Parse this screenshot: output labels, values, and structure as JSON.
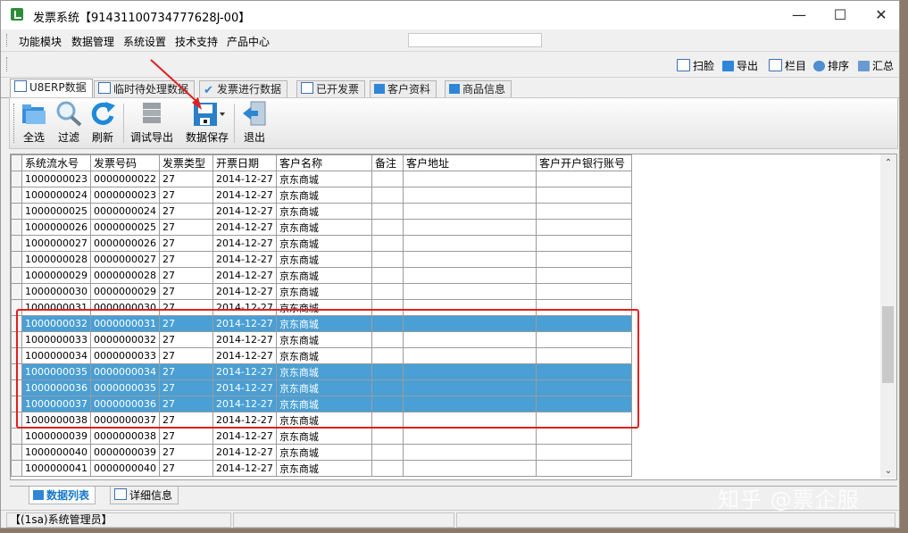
{
  "window": {
    "title": "发票系统【91431100734777628J-00】"
  },
  "menu": {
    "items": [
      "功能模块",
      "数据管理",
      "系统设置",
      "技术支持",
      "产品中心"
    ]
  },
  "toolbar2": {
    "items": [
      "扫脸",
      "导出",
      "栏目",
      "排序",
      "汇总"
    ]
  },
  "tabs": [
    "U8ERP数据",
    "临时待处理数据",
    "发票进行数据",
    "已开发票",
    "客户资料",
    "商品信息"
  ],
  "ribbon": {
    "buttons": [
      "全选",
      "过滤",
      "刷新",
      "调试导出",
      "数据保存",
      "退出"
    ]
  },
  "grid": {
    "columns": [
      "系统流水号",
      "发票号码",
      "发票类型",
      "开票日期",
      "客户名称",
      "备注",
      "客户地址",
      "客户开户银行账号"
    ],
    "rows": [
      {
        "cells": [
          "1000000023",
          "0000000022",
          "27",
          "2014-12-27",
          "京东商城",
          "",
          "",
          ""
        ],
        "selected": false
      },
      {
        "cells": [
          "1000000024",
          "0000000023",
          "27",
          "2014-12-27",
          "京东商城",
          "",
          "",
          ""
        ],
        "selected": false
      },
      {
        "cells": [
          "1000000025",
          "0000000024",
          "27",
          "2014-12-27",
          "京东商城",
          "",
          "",
          ""
        ],
        "selected": false
      },
      {
        "cells": [
          "1000000026",
          "0000000025",
          "27",
          "2014-12-27",
          "京东商城",
          "",
          "",
          ""
        ],
        "selected": false
      },
      {
        "cells": [
          "1000000027",
          "0000000026",
          "27",
          "2014-12-27",
          "京东商城",
          "",
          "",
          ""
        ],
        "selected": false
      },
      {
        "cells": [
          "1000000028",
          "0000000027",
          "27",
          "2014-12-27",
          "京东商城",
          "",
          "",
          ""
        ],
        "selected": false
      },
      {
        "cells": [
          "1000000029",
          "0000000028",
          "27",
          "2014-12-27",
          "京东商城",
          "",
          "",
          ""
        ],
        "selected": false
      },
      {
        "cells": [
          "1000000030",
          "0000000029",
          "27",
          "2014-12-27",
          "京东商城",
          "",
          "",
          ""
        ],
        "selected": false
      },
      {
        "cells": [
          "1000000031",
          "0000000030",
          "27",
          "2014-12-27",
          "京东商城",
          "",
          "",
          ""
        ],
        "selected": false
      },
      {
        "cells": [
          "1000000032",
          "0000000031",
          "27",
          "2014-12-27",
          "京东商城",
          "",
          "",
          ""
        ],
        "selected": true
      },
      {
        "cells": [
          "1000000033",
          "0000000032",
          "27",
          "2014-12-27",
          "京东商城",
          "",
          "",
          ""
        ],
        "selected": false
      },
      {
        "cells": [
          "1000000034",
          "0000000033",
          "27",
          "2014-12-27",
          "京东商城",
          "",
          "",
          ""
        ],
        "selected": false
      },
      {
        "cells": [
          "1000000035",
          "0000000034",
          "27",
          "2014-12-27",
          "京东商城",
          "",
          "",
          ""
        ],
        "selected": true
      },
      {
        "cells": [
          "1000000036",
          "0000000035",
          "27",
          "2014-12-27",
          "京东商城",
          "",
          "",
          ""
        ],
        "selected": true
      },
      {
        "cells": [
          "1000000037",
          "0000000036",
          "27",
          "2014-12-27",
          "京东商城",
          "",
          "",
          ""
        ],
        "selected": true
      },
      {
        "cells": [
          "1000000038",
          "0000000037",
          "27",
          "2014-12-27",
          "京东商城",
          "",
          "",
          ""
        ],
        "selected": false
      },
      {
        "cells": [
          "1000000039",
          "0000000038",
          "27",
          "2014-12-27",
          "京东商城",
          "",
          "",
          ""
        ],
        "selected": false
      },
      {
        "cells": [
          "1000000040",
          "0000000039",
          "27",
          "2014-12-27",
          "京东商城",
          "",
          "",
          ""
        ],
        "selected": false
      },
      {
        "cells": [
          "1000000041",
          "0000000040",
          "27",
          "2014-12-27",
          "京东商城",
          "",
          "",
          ""
        ],
        "selected": false
      }
    ]
  },
  "bottom_tabs": [
    "数据列表",
    "详细信息"
  ],
  "status": {
    "user": "【(1sa)系统管理员】"
  },
  "watermark": "知乎 @票企服",
  "colors": {
    "selection": "#4a9fd4",
    "highlight_box": "#e02020",
    "active_tab_text": "#1677c9"
  }
}
